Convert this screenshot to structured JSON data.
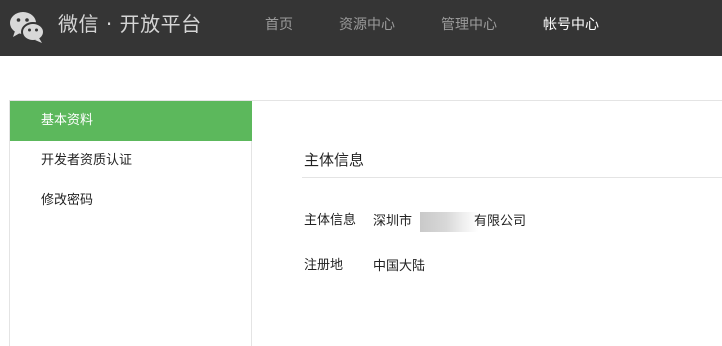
{
  "header": {
    "brand": "微信 · 开放平台",
    "logo_icon": "wechat-logo-icon",
    "nav": [
      {
        "label": "首页",
        "active": false
      },
      {
        "label": "资源中心",
        "active": false
      },
      {
        "label": "管理中心",
        "active": false
      },
      {
        "label": "帐号中心",
        "active": true
      }
    ]
  },
  "sidebar": {
    "items": [
      {
        "label": "基本资料",
        "active": true
      },
      {
        "label": "开发者资质认证",
        "active": false
      },
      {
        "label": "修改密码",
        "active": false
      }
    ]
  },
  "main": {
    "section_title": "主体信息",
    "rows": [
      {
        "label": "主体信息",
        "value_prefix": "深圳市",
        "value_suffix": "有限公司"
      },
      {
        "label": "注册地",
        "value": "中国大陆"
      }
    ]
  },
  "colors": {
    "topbar": "#353535",
    "accent_green": "#5cb85c"
  }
}
